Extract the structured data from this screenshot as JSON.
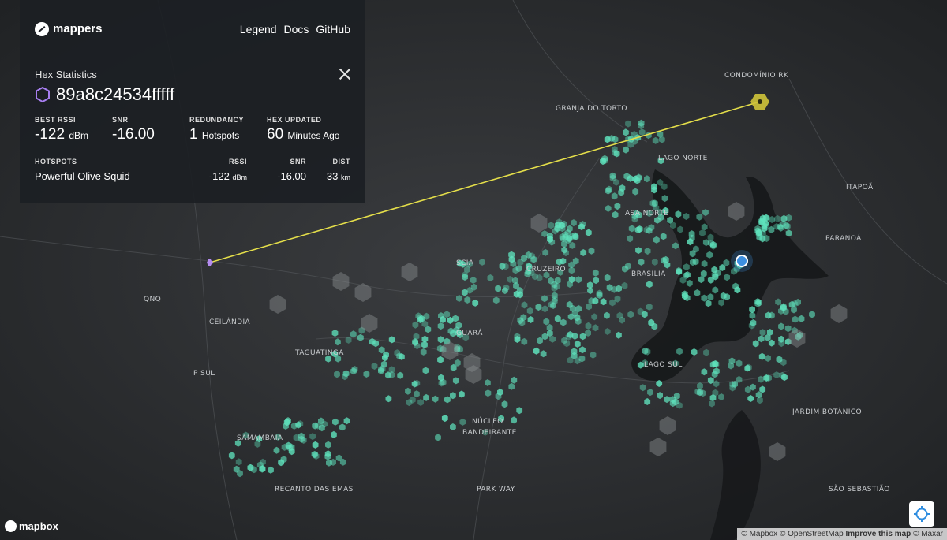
{
  "brand": {
    "name": "mappers"
  },
  "nav": [
    {
      "label": "Legend"
    },
    {
      "label": "Docs"
    },
    {
      "label": "GitHub"
    }
  ],
  "hex_stats": {
    "title": "Hex Statistics",
    "hex_id": "89a8c24534fffff",
    "metrics": [
      {
        "label": "BEST RSSI",
        "value": "-122",
        "unit": "dBm"
      },
      {
        "label": "SNR",
        "value": "-16.00",
        "unit": ""
      },
      {
        "label": "REDUNDANCY",
        "value": "1",
        "unit": "Hotspots"
      },
      {
        "label": "HEX UPDATED",
        "value": "60",
        "unit": "Minutes Ago"
      }
    ],
    "hotspots_header": {
      "name": "HOTSPOTS",
      "rssi": "RSSI",
      "snr": "SNR",
      "dist": "DIST"
    },
    "hotspots": [
      {
        "name": "Powerful Olive Squid",
        "rssi": "-122",
        "rssi_unit": "dBm",
        "snr": "-16.00",
        "dist": "33",
        "dist_unit": "km"
      }
    ]
  },
  "map_labels": [
    "CONDOMÍNIO RK",
    "GRANJA DO TORTO",
    "LAGO NORTE",
    "ITAPOÃ",
    "ASA NORTE",
    "PARANOÁ",
    "SCIA",
    "CRUZEIRO",
    "BRASÍLIA",
    "QNQ",
    "CEILÂNDIA",
    "GUARÁ",
    "TAGUATINGA",
    "LAGO SUL",
    "P SUL",
    "NÚCLEO",
    "BANDEIRANTE",
    "JARDIM BOTÂNICO",
    "SAMAMBAIA",
    "RECANTO DAS EMAS",
    "PARK WAY",
    "SÃO SEBASTIÃO"
  ],
  "colors": {
    "coverage": "#5fe3bd",
    "link": "#e4de4a",
    "hotspot": "#cfc43a",
    "selected_hex": "#b48cf0",
    "user_location": "#3d8fe0"
  },
  "mapbox_logo": "mapbox",
  "attribution": {
    "mapbox": "© Mapbox",
    "osm": "© OpenStreetMap",
    "improve": "Improve this map",
    "maxar": "© Maxar"
  },
  "icons": {
    "hex": "hexagon-icon",
    "close": "close-icon",
    "locate": "crosshair-icon"
  }
}
